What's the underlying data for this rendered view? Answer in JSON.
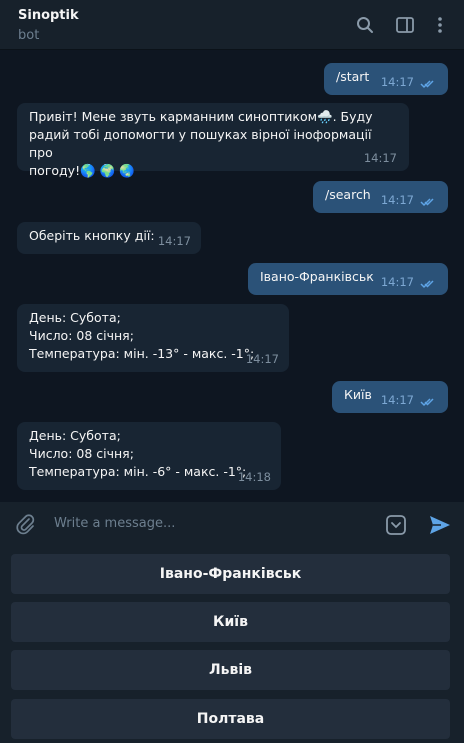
{
  "header": {
    "title": "Sinoptik",
    "subtitle": "bot"
  },
  "messages": [
    {
      "text": "/start",
      "time": "14:17"
    },
    {
      "text": "Привіт! Мене звуть карманним синоптиком🌧️. Буду\nрадий тобі допомогти у пошуках вірної іноформації про\nпогоду!🌎 🌍 🌏",
      "time": "14:17"
    },
    {
      "text": "/search",
      "time": "14:17"
    },
    {
      "text": "Оберіть кнопку дії:",
      "time": "14:17"
    },
    {
      "text": "Івано-Франківськ",
      "time": "14:17"
    },
    {
      "text": "День: Субота;\nЧисло: 08 січня;\nТемпература: мін. -13° - макс. -1°;",
      "time": "14:17"
    },
    {
      "text": "Київ",
      "time": "14:17"
    },
    {
      "text": "День: Субота;\nЧисло: 08 січня;\nТемпература: мін. -6° - макс. -1°;",
      "time": "14:18"
    }
  ],
  "input": {
    "placeholder": "Write a message..."
  },
  "keyboard": {
    "buttons": [
      "Івано-Франківськ",
      "Київ",
      "Львів",
      "Полтава"
    ]
  },
  "colors": {
    "background": "#0e1621",
    "panel": "#17212b",
    "outgoing_bubble": "#2b5278",
    "incoming_bubble": "#182533",
    "accent": "#5ea4e6"
  },
  "icons": [
    "search-icon",
    "sidebar-toggle-icon",
    "more-vertical-icon",
    "attach-icon",
    "bot-keyboard-icon",
    "send-icon",
    "double-check-icon"
  ]
}
